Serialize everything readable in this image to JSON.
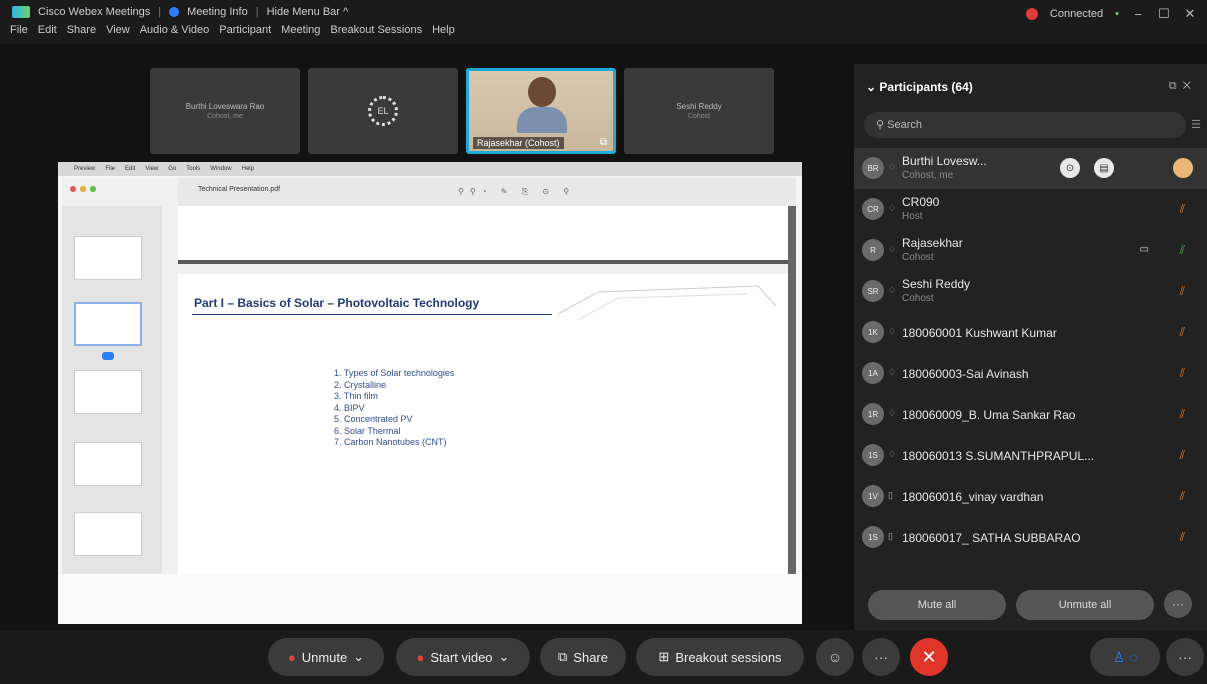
{
  "titlebar": {
    "app_name": "Cisco Webex Meetings",
    "meeting_info": "Meeting Info",
    "hide_menu": "Hide Menu Bar ^",
    "status": "Connected",
    "connected_dot": "•",
    "minimize": "−",
    "maximize": "☐",
    "close": "✕"
  },
  "menu": [
    "File",
    "Edit",
    "Share",
    "View",
    "Audio & Video",
    "Participant",
    "Meeting",
    "Breakout Sessions",
    "Help"
  ],
  "video_strip": {
    "tiles": [
      {
        "name": "Burthi Loveswara Rao",
        "role": "Cohost, me"
      },
      {
        "name": "",
        "role": ""
      },
      {
        "name": "Rajasekhar (Cohost)",
        "role": ""
      },
      {
        "name": "Seshi Reddy",
        "role": "Cohost"
      }
    ]
  },
  "shared_content": {
    "mac_menu": [
      "Preview",
      "File",
      "Edit",
      "View",
      "Go",
      "Tools",
      "Window",
      "Help"
    ],
    "file_name": "Technical Presentation.pdf",
    "slide_title": "Part I – Basics of Solar – Photovoltaic Technology",
    "list": [
      "1.   Types of Solar technologies",
      "2.   Crystalline",
      "3.   Thin film",
      "4.   BIPV",
      "5.   Concentrated PV",
      "6.   Solar Thermal",
      "7.   Carbon Nanotubes (CNT)"
    ]
  },
  "panel": {
    "title": "Participants (64)",
    "search_placeholder": "Search",
    "mute_all": "Mute all",
    "unmute_all": "Unmute all",
    "more": "···",
    "participants": [
      {
        "initials": "BR",
        "name": "Burthi Lovesw...",
        "role": "Cohost, me"
      },
      {
        "initials": "CR",
        "name": "CR090",
        "role": "Host"
      },
      {
        "initials": "R",
        "name": "Rajasekhar",
        "role": "Cohost"
      },
      {
        "initials": "SR",
        "name": "Seshi Reddy",
        "role": "Cohost"
      },
      {
        "initials": "1K",
        "name": "180060001 Kushwant Kumar",
        "role": ""
      },
      {
        "initials": "1A",
        "name": "180060003-Sai Avinash",
        "role": ""
      },
      {
        "initials": "1R",
        "name": "180060009_B. Uma Sankar Rao",
        "role": ""
      },
      {
        "initials": "1S",
        "name": "180060013 S.SUMANTHPRAPUL...",
        "role": ""
      },
      {
        "initials": "1V",
        "name": "180060016_vinay vardhan",
        "role": ""
      },
      {
        "initials": "1S",
        "name": "180060017_ SATHA SUBBARAO",
        "role": ""
      }
    ]
  },
  "controls": {
    "unmute": "Unmute",
    "start_video": "Start video",
    "share": "Share",
    "breakout": "Breakout sessions",
    "more": "···"
  }
}
